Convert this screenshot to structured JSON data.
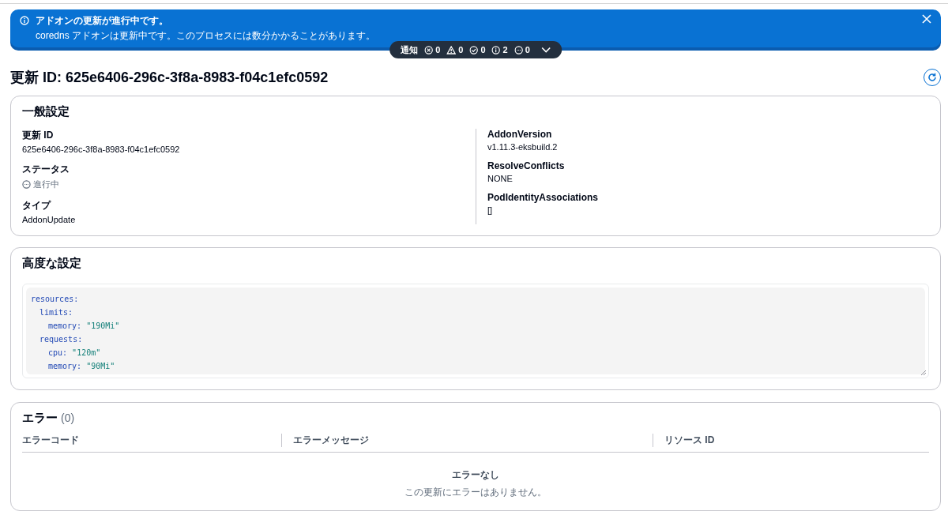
{
  "banner": {
    "title": "アドオンの更新が進行中です。",
    "message": "coredns アドオンは更新中です。このプロセスには数分かかることがあります。"
  },
  "notifications": {
    "label": "通知",
    "counts": [
      {
        "kind": "error",
        "value": "0"
      },
      {
        "kind": "warning",
        "value": "0"
      },
      {
        "kind": "success",
        "value": "0"
      },
      {
        "kind": "info",
        "value": "2"
      },
      {
        "kind": "progress",
        "value": "0"
      }
    ],
    "expanded": false
  },
  "page_title": "更新 ID: 625e6406-296c-3f8a-8983-f04c1efc0592",
  "general": {
    "title": "一般設定",
    "columns": [
      [
        {
          "label": "更新 ID",
          "value": "625e6406-296c-3f8a-8983-f04c1efc0592"
        },
        {
          "label": "ステータス",
          "value": "進行中",
          "kind": "status"
        },
        {
          "label": "タイプ",
          "value": "AddonUpdate"
        }
      ],
      [
        {
          "label": "AddonVersion",
          "value": "v1.11.3-eksbuild.2"
        },
        {
          "label": "ResolveConflicts",
          "value": "NONE"
        },
        {
          "label": "PodIdentityAssociations",
          "value": "[]"
        }
      ]
    ]
  },
  "advanced": {
    "title": "高度な設定",
    "code": [
      {
        "key": "resources:",
        "children": [
          {
            "key": "limits:",
            "children": [
              {
                "key": "memory:",
                "value": "\"190Mi\""
              }
            ]
          },
          {
            "key": "requests:",
            "children": [
              {
                "key": "cpu:",
                "value": "\"120m\""
              },
              {
                "key": "memory:",
                "value": "\"90Mi\""
              }
            ]
          }
        ]
      }
    ]
  },
  "errors": {
    "title": "エラー",
    "count": "(0)",
    "columns": [
      "エラーコード",
      "エラーメッセージ",
      "リソース ID"
    ],
    "empty_title": "エラーなし",
    "empty_message": "この更新にエラーはありません。"
  }
}
